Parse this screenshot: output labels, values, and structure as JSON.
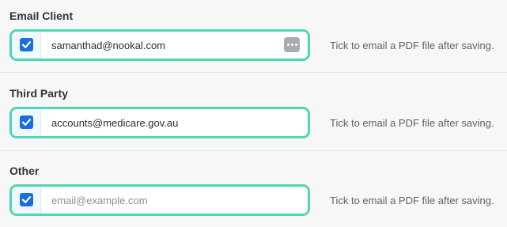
{
  "sections": [
    {
      "title": "Email Client",
      "checked": true,
      "email_value": "samanthad@nookal.com",
      "email_placeholder": "",
      "has_more_button": true,
      "hint": "Tick to email a PDF file after saving."
    },
    {
      "title": "Third Party",
      "checked": true,
      "email_value": "accounts@medicare.gov.au",
      "email_placeholder": "",
      "has_more_button": false,
      "hint": "Tick to email a PDF file after saving."
    },
    {
      "title": "Other",
      "checked": true,
      "email_value": "",
      "email_placeholder": "email@example.com",
      "has_more_button": false,
      "hint": "Tick to email a PDF file after saving."
    }
  ],
  "icons": {
    "checkbox": "checkmark-icon",
    "more": "ellipsis-icon"
  },
  "colors": {
    "highlight_border": "#4fd6b4",
    "checkbox_fill": "#1a6fe0",
    "check_cell_bg": "#eef8fd",
    "more_button_bg": "#a9abb0"
  }
}
